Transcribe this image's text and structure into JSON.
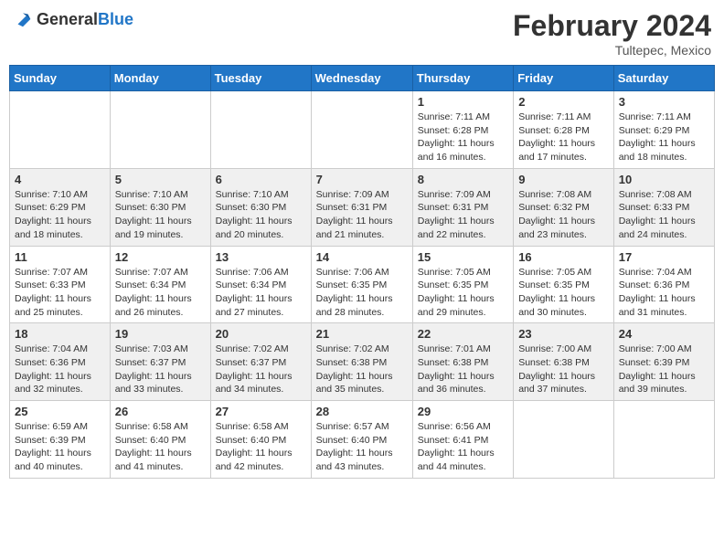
{
  "header": {
    "logo_general": "General",
    "logo_blue": "Blue",
    "month_title": "February 2024",
    "location": "Tultepec, Mexico"
  },
  "weekdays": [
    "Sunday",
    "Monday",
    "Tuesday",
    "Wednesday",
    "Thursday",
    "Friday",
    "Saturday"
  ],
  "weeks": [
    [
      {
        "day": "",
        "info": ""
      },
      {
        "day": "",
        "info": ""
      },
      {
        "day": "",
        "info": ""
      },
      {
        "day": "",
        "info": ""
      },
      {
        "day": "1",
        "info": "Sunrise: 7:11 AM\nSunset: 6:28 PM\nDaylight: 11 hours and 16 minutes."
      },
      {
        "day": "2",
        "info": "Sunrise: 7:11 AM\nSunset: 6:28 PM\nDaylight: 11 hours and 17 minutes."
      },
      {
        "day": "3",
        "info": "Sunrise: 7:11 AM\nSunset: 6:29 PM\nDaylight: 11 hours and 18 minutes."
      }
    ],
    [
      {
        "day": "4",
        "info": "Sunrise: 7:10 AM\nSunset: 6:29 PM\nDaylight: 11 hours and 18 minutes."
      },
      {
        "day": "5",
        "info": "Sunrise: 7:10 AM\nSunset: 6:30 PM\nDaylight: 11 hours and 19 minutes."
      },
      {
        "day": "6",
        "info": "Sunrise: 7:10 AM\nSunset: 6:30 PM\nDaylight: 11 hours and 20 minutes."
      },
      {
        "day": "7",
        "info": "Sunrise: 7:09 AM\nSunset: 6:31 PM\nDaylight: 11 hours and 21 minutes."
      },
      {
        "day": "8",
        "info": "Sunrise: 7:09 AM\nSunset: 6:31 PM\nDaylight: 11 hours and 22 minutes."
      },
      {
        "day": "9",
        "info": "Sunrise: 7:08 AM\nSunset: 6:32 PM\nDaylight: 11 hours and 23 minutes."
      },
      {
        "day": "10",
        "info": "Sunrise: 7:08 AM\nSunset: 6:33 PM\nDaylight: 11 hours and 24 minutes."
      }
    ],
    [
      {
        "day": "11",
        "info": "Sunrise: 7:07 AM\nSunset: 6:33 PM\nDaylight: 11 hours and 25 minutes."
      },
      {
        "day": "12",
        "info": "Sunrise: 7:07 AM\nSunset: 6:34 PM\nDaylight: 11 hours and 26 minutes."
      },
      {
        "day": "13",
        "info": "Sunrise: 7:06 AM\nSunset: 6:34 PM\nDaylight: 11 hours and 27 minutes."
      },
      {
        "day": "14",
        "info": "Sunrise: 7:06 AM\nSunset: 6:35 PM\nDaylight: 11 hours and 28 minutes."
      },
      {
        "day": "15",
        "info": "Sunrise: 7:05 AM\nSunset: 6:35 PM\nDaylight: 11 hours and 29 minutes."
      },
      {
        "day": "16",
        "info": "Sunrise: 7:05 AM\nSunset: 6:35 PM\nDaylight: 11 hours and 30 minutes."
      },
      {
        "day": "17",
        "info": "Sunrise: 7:04 AM\nSunset: 6:36 PM\nDaylight: 11 hours and 31 minutes."
      }
    ],
    [
      {
        "day": "18",
        "info": "Sunrise: 7:04 AM\nSunset: 6:36 PM\nDaylight: 11 hours and 32 minutes."
      },
      {
        "day": "19",
        "info": "Sunrise: 7:03 AM\nSunset: 6:37 PM\nDaylight: 11 hours and 33 minutes."
      },
      {
        "day": "20",
        "info": "Sunrise: 7:02 AM\nSunset: 6:37 PM\nDaylight: 11 hours and 34 minutes."
      },
      {
        "day": "21",
        "info": "Sunrise: 7:02 AM\nSunset: 6:38 PM\nDaylight: 11 hours and 35 minutes."
      },
      {
        "day": "22",
        "info": "Sunrise: 7:01 AM\nSunset: 6:38 PM\nDaylight: 11 hours and 36 minutes."
      },
      {
        "day": "23",
        "info": "Sunrise: 7:00 AM\nSunset: 6:38 PM\nDaylight: 11 hours and 37 minutes."
      },
      {
        "day": "24",
        "info": "Sunrise: 7:00 AM\nSunset: 6:39 PM\nDaylight: 11 hours and 39 minutes."
      }
    ],
    [
      {
        "day": "25",
        "info": "Sunrise: 6:59 AM\nSunset: 6:39 PM\nDaylight: 11 hours and 40 minutes."
      },
      {
        "day": "26",
        "info": "Sunrise: 6:58 AM\nSunset: 6:40 PM\nDaylight: 11 hours and 41 minutes."
      },
      {
        "day": "27",
        "info": "Sunrise: 6:58 AM\nSunset: 6:40 PM\nDaylight: 11 hours and 42 minutes."
      },
      {
        "day": "28",
        "info": "Sunrise: 6:57 AM\nSunset: 6:40 PM\nDaylight: 11 hours and 43 minutes."
      },
      {
        "day": "29",
        "info": "Sunrise: 6:56 AM\nSunset: 6:41 PM\nDaylight: 11 hours and 44 minutes."
      },
      {
        "day": "",
        "info": ""
      },
      {
        "day": "",
        "info": ""
      }
    ]
  ]
}
